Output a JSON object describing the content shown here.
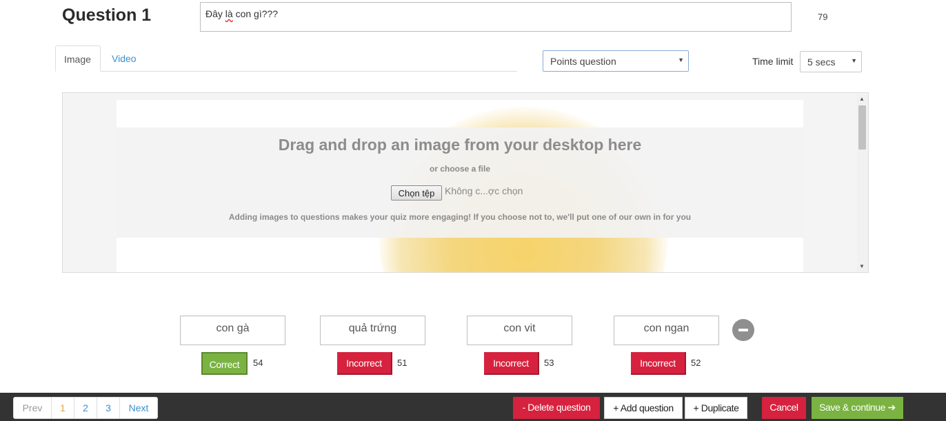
{
  "question": {
    "title": "Question 1",
    "text_before": "Đây ",
    "text_underlined": "là",
    "text_after": " con gì???",
    "char_count": "79"
  },
  "tabs": [
    {
      "label": "Image",
      "active": true
    },
    {
      "label": "Video",
      "active": false
    }
  ],
  "question_type": {
    "selected": "Points question"
  },
  "time_limit": {
    "label": "Time limit",
    "selected": "5 secs"
  },
  "media": {
    "drop_title": "Drag and drop an image from your desktop here",
    "choose_text": "or choose a file",
    "file_button": "Chọn tệp",
    "file_status": "Không c...ợc chọn",
    "hint": "Adding images to questions makes your quiz more engaging! If you choose not to, we'll put one of our own in for you"
  },
  "answers": [
    {
      "text": "con gà",
      "status": "Correct",
      "count": "54"
    },
    {
      "text": "quả trứng",
      "status": "Incorrect",
      "count": "51"
    },
    {
      "text": "con vit",
      "status": "Incorrect",
      "count": "53"
    },
    {
      "text": "con ngan",
      "status": "Incorrect",
      "count": "52"
    }
  ],
  "pagination": {
    "prev": "Prev",
    "pages": [
      "1",
      "2",
      "3"
    ],
    "next": "Next",
    "current": "1"
  },
  "actions": {
    "delete": "- Delete question",
    "add": "+ Add question",
    "duplicate": "+ Duplicate",
    "cancel": "Cancel",
    "save": "Save & continue ➔"
  },
  "colors": {
    "correct": "#7ab342",
    "incorrect": "#d6223e",
    "link": "#3a8fd0",
    "bottom_bar": "#333333"
  }
}
